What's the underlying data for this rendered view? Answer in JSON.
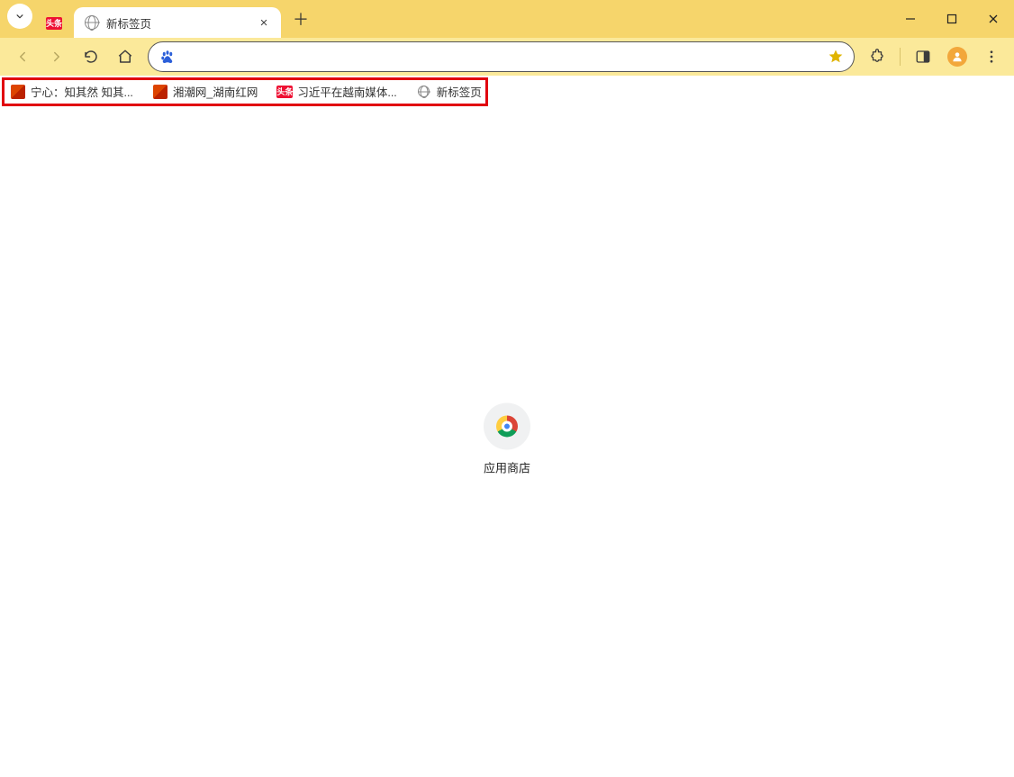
{
  "tab": {
    "title": "新标签页"
  },
  "omnibox": {
    "placeholder": ""
  },
  "bookmarks": {
    "b1": "宁心：知其然 知其...",
    "b2": "湘潮网_湖南红网",
    "b3": "习近平在越南媒体...",
    "b4": "新标签页"
  },
  "ntp": {
    "shortcut_label": "应用商店"
  }
}
